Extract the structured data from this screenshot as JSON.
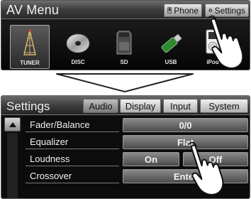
{
  "av_menu": {
    "title": "AV Menu",
    "phone_label": "Phone",
    "settings_label": "Settings",
    "sources": [
      {
        "label": "TUNER",
        "icon": "tuner-tower-icon",
        "selected": true
      },
      {
        "label": "DISC",
        "icon": "disc-icon",
        "selected": false
      },
      {
        "label": "SD",
        "icon": "sd-card-icon",
        "selected": false
      },
      {
        "label": "USB",
        "icon": "usb-drive-icon",
        "selected": false
      },
      {
        "label": "iPod",
        "icon": "ipod-icon",
        "selected": false
      }
    ]
  },
  "settings": {
    "title": "Settings",
    "tabs": [
      {
        "label": "Audio",
        "active": true
      },
      {
        "label": "Display",
        "active": false
      },
      {
        "label": "Input",
        "active": false
      },
      {
        "label": "System",
        "active": false
      }
    ],
    "rows": [
      {
        "label": "Fader/Balance",
        "value": "0/0"
      },
      {
        "label": "Equalizer",
        "value": "Flat"
      },
      {
        "label": "Loudness",
        "on_label": "On",
        "off_label": "Off"
      },
      {
        "label": "Crossover",
        "value": "Enter"
      }
    ]
  },
  "colors": {
    "panel_bg": "#0c0c0c",
    "button_light": "#e8e8e8",
    "button_dark": "#4a4a4a",
    "text_light": "#f2f2f2"
  }
}
